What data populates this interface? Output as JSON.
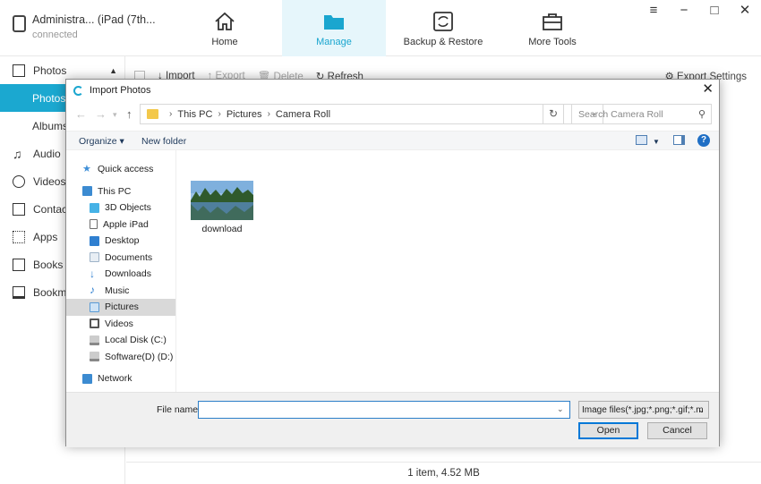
{
  "app": {
    "device_name": "Administra... (iPad (7th...",
    "device_status": "connected",
    "nav_tabs": [
      {
        "label": "Home",
        "icon": "home-icon"
      },
      {
        "label": "Manage",
        "icon": "folder-icon"
      },
      {
        "label": "Backup & Restore",
        "icon": "backup-icon"
      },
      {
        "label": "More Tools",
        "icon": "toolbox-icon"
      }
    ],
    "active_tab": "Manage",
    "accent_color": "#1ba8d0",
    "sidebar": [
      {
        "label": "Photos",
        "icon": "photos-icon"
      },
      {
        "label": "Photos",
        "icon": ""
      },
      {
        "label": "Albums",
        "icon": ""
      },
      {
        "label": "Audio",
        "icon": "music-icon"
      },
      {
        "label": "Videos",
        "icon": "video-icon"
      },
      {
        "label": "Contact",
        "icon": "contact-icon"
      },
      {
        "label": "Apps",
        "icon": "apps-icon"
      },
      {
        "label": "Books",
        "icon": "book-icon"
      },
      {
        "label": "Bookma",
        "icon": "bookmark-icon"
      }
    ],
    "toolbar": {
      "import": "Import",
      "export": "Export",
      "delete": "Delete",
      "refresh": "Refresh",
      "export_settings": "Export Settings"
    },
    "status": "1 item, 4.52 MB"
  },
  "dialog": {
    "title": "Import Photos",
    "breadcrumb": [
      "This PC",
      "Pictures",
      "Camera Roll"
    ],
    "search_placeholder": "Search Camera Roll",
    "organize": "Organize ▾",
    "new_folder": "New folder",
    "help": "?",
    "nav": [
      {
        "label": "Quick access",
        "icon": "star-icon",
        "color": "#3f8fd8"
      },
      {
        "label": "This PC",
        "icon": "computer-icon",
        "color": "#3c8bd1"
      },
      {
        "label": "3D Objects",
        "icon": "cube-icon",
        "color": "#46b2e6"
      },
      {
        "label": "Apple iPad",
        "icon": "ipad-icon",
        "color": "#6d6d6d"
      },
      {
        "label": "Desktop",
        "icon": "desktop-icon",
        "color": "#2f7fd0"
      },
      {
        "label": "Documents",
        "icon": "documents-icon",
        "color": "#9eb3c8"
      },
      {
        "label": "Downloads",
        "icon": "download-arrow-icon",
        "color": "#2f7fd0"
      },
      {
        "label": "Music",
        "icon": "music-note-icon",
        "color": "#2f7fd0"
      },
      {
        "label": "Pictures",
        "icon": "pictures-icon",
        "color": "#5a9bd5"
      },
      {
        "label": "Videos",
        "icon": "film-icon",
        "color": "#555555"
      },
      {
        "label": "Local Disk (C:)",
        "icon": "disk-icon",
        "color": "#888888"
      },
      {
        "label": "Software(D) (D:)",
        "icon": "disk-icon",
        "color": "#888888"
      },
      {
        "label": "Network",
        "icon": "network-icon",
        "color": "#3c8bd1"
      }
    ],
    "selected_nav": "Pictures",
    "files": [
      {
        "name": "download",
        "icon": "landscape-thumbnail"
      }
    ],
    "file_name_label": "File name:",
    "file_name_value": "",
    "file_type": "Image files(*.jpg;*.png;*.gif;*.m",
    "open": "Open",
    "cancel": "Cancel"
  }
}
